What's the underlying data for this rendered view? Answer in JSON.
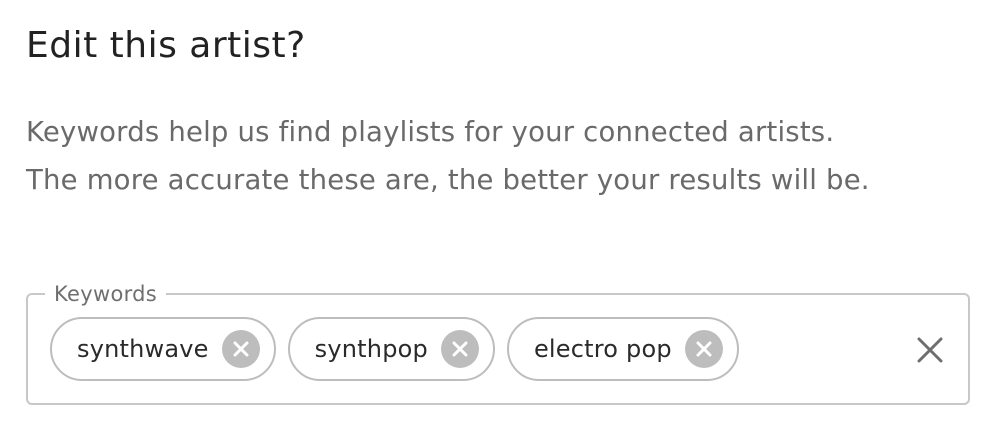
{
  "dialog": {
    "title": "Edit this artist?",
    "description_lines": [
      "Keywords help us find playlists for your connected artists.",
      "The more accurate these are, the better your results will be."
    ]
  },
  "keywords_field": {
    "label": "Keywords",
    "chips": [
      {
        "label": "synthwave",
        "delete_icon": "cancel-circle-icon"
      },
      {
        "label": "synthpop",
        "delete_icon": "cancel-circle-icon"
      },
      {
        "label": "electro pop",
        "delete_icon": "cancel-circle-icon"
      }
    ],
    "clear_icon": "close-icon"
  },
  "colors": {
    "text_primary": "#222222",
    "text_secondary": "#6a6a6a",
    "border": "#c8c8c8",
    "chip_border": "#bdbdbd",
    "chip_delete_bg": "#bdbdbd",
    "clear_icon": "#6e6e6e"
  }
}
